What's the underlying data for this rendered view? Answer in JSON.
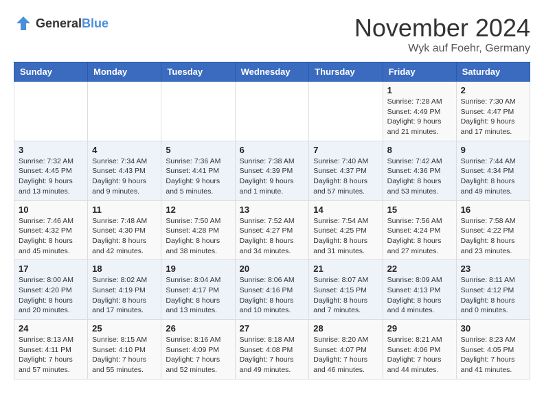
{
  "header": {
    "logo_general": "General",
    "logo_blue": "Blue",
    "month": "November 2024",
    "location": "Wyk auf Foehr, Germany"
  },
  "weekdays": [
    "Sunday",
    "Monday",
    "Tuesday",
    "Wednesday",
    "Thursday",
    "Friday",
    "Saturday"
  ],
  "weeks": [
    [
      {
        "day": "",
        "info": ""
      },
      {
        "day": "",
        "info": ""
      },
      {
        "day": "",
        "info": ""
      },
      {
        "day": "",
        "info": ""
      },
      {
        "day": "",
        "info": ""
      },
      {
        "day": "1",
        "info": "Sunrise: 7:28 AM\nSunset: 4:49 PM\nDaylight: 9 hours\nand 21 minutes."
      },
      {
        "day": "2",
        "info": "Sunrise: 7:30 AM\nSunset: 4:47 PM\nDaylight: 9 hours\nand 17 minutes."
      }
    ],
    [
      {
        "day": "3",
        "info": "Sunrise: 7:32 AM\nSunset: 4:45 PM\nDaylight: 9 hours\nand 13 minutes."
      },
      {
        "day": "4",
        "info": "Sunrise: 7:34 AM\nSunset: 4:43 PM\nDaylight: 9 hours\nand 9 minutes."
      },
      {
        "day": "5",
        "info": "Sunrise: 7:36 AM\nSunset: 4:41 PM\nDaylight: 9 hours\nand 5 minutes."
      },
      {
        "day": "6",
        "info": "Sunrise: 7:38 AM\nSunset: 4:39 PM\nDaylight: 9 hours\nand 1 minute."
      },
      {
        "day": "7",
        "info": "Sunrise: 7:40 AM\nSunset: 4:37 PM\nDaylight: 8 hours\nand 57 minutes."
      },
      {
        "day": "8",
        "info": "Sunrise: 7:42 AM\nSunset: 4:36 PM\nDaylight: 8 hours\nand 53 minutes."
      },
      {
        "day": "9",
        "info": "Sunrise: 7:44 AM\nSunset: 4:34 PM\nDaylight: 8 hours\nand 49 minutes."
      }
    ],
    [
      {
        "day": "10",
        "info": "Sunrise: 7:46 AM\nSunset: 4:32 PM\nDaylight: 8 hours\nand 45 minutes."
      },
      {
        "day": "11",
        "info": "Sunrise: 7:48 AM\nSunset: 4:30 PM\nDaylight: 8 hours\nand 42 minutes."
      },
      {
        "day": "12",
        "info": "Sunrise: 7:50 AM\nSunset: 4:28 PM\nDaylight: 8 hours\nand 38 minutes."
      },
      {
        "day": "13",
        "info": "Sunrise: 7:52 AM\nSunset: 4:27 PM\nDaylight: 8 hours\nand 34 minutes."
      },
      {
        "day": "14",
        "info": "Sunrise: 7:54 AM\nSunset: 4:25 PM\nDaylight: 8 hours\nand 31 minutes."
      },
      {
        "day": "15",
        "info": "Sunrise: 7:56 AM\nSunset: 4:24 PM\nDaylight: 8 hours\nand 27 minutes."
      },
      {
        "day": "16",
        "info": "Sunrise: 7:58 AM\nSunset: 4:22 PM\nDaylight: 8 hours\nand 23 minutes."
      }
    ],
    [
      {
        "day": "17",
        "info": "Sunrise: 8:00 AM\nSunset: 4:20 PM\nDaylight: 8 hours\nand 20 minutes."
      },
      {
        "day": "18",
        "info": "Sunrise: 8:02 AM\nSunset: 4:19 PM\nDaylight: 8 hours\nand 17 minutes."
      },
      {
        "day": "19",
        "info": "Sunrise: 8:04 AM\nSunset: 4:17 PM\nDaylight: 8 hours\nand 13 minutes."
      },
      {
        "day": "20",
        "info": "Sunrise: 8:06 AM\nSunset: 4:16 PM\nDaylight: 8 hours\nand 10 minutes."
      },
      {
        "day": "21",
        "info": "Sunrise: 8:07 AM\nSunset: 4:15 PM\nDaylight: 8 hours\nand 7 minutes."
      },
      {
        "day": "22",
        "info": "Sunrise: 8:09 AM\nSunset: 4:13 PM\nDaylight: 8 hours\nand 4 minutes."
      },
      {
        "day": "23",
        "info": "Sunrise: 8:11 AM\nSunset: 4:12 PM\nDaylight: 8 hours\nand 0 minutes."
      }
    ],
    [
      {
        "day": "24",
        "info": "Sunrise: 8:13 AM\nSunset: 4:11 PM\nDaylight: 7 hours\nand 57 minutes."
      },
      {
        "day": "25",
        "info": "Sunrise: 8:15 AM\nSunset: 4:10 PM\nDaylight: 7 hours\nand 55 minutes."
      },
      {
        "day": "26",
        "info": "Sunrise: 8:16 AM\nSunset: 4:09 PM\nDaylight: 7 hours\nand 52 minutes."
      },
      {
        "day": "27",
        "info": "Sunrise: 8:18 AM\nSunset: 4:08 PM\nDaylight: 7 hours\nand 49 minutes."
      },
      {
        "day": "28",
        "info": "Sunrise: 8:20 AM\nSunset: 4:07 PM\nDaylight: 7 hours\nand 46 minutes."
      },
      {
        "day": "29",
        "info": "Sunrise: 8:21 AM\nSunset: 4:06 PM\nDaylight: 7 hours\nand 44 minutes."
      },
      {
        "day": "30",
        "info": "Sunrise: 8:23 AM\nSunset: 4:05 PM\nDaylight: 7 hours\nand 41 minutes."
      }
    ]
  ]
}
